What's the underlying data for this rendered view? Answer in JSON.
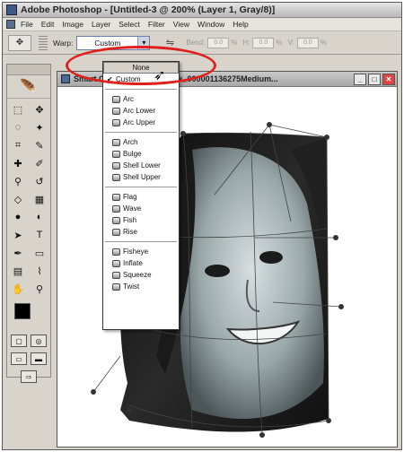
{
  "titlebar": {
    "title": "Adobe Photoshop - [Untitled-3 @ 200% (Layer 1, Gray/8)]"
  },
  "menubar": {
    "items": [
      "File",
      "Edit",
      "Image",
      "Layer",
      "Select",
      "Filter",
      "View",
      "Window",
      "Help"
    ]
  },
  "options": {
    "warp_label": "Warp:",
    "warp_value": "Custom",
    "bend_label": "Bend:",
    "bend_value": "0.0",
    "h_label": "H:",
    "h_value": "0.0",
    "v_label": "V:",
    "v_value": "0.0",
    "pct": "%"
  },
  "document": {
    "title": "Smart Object... 200% (iStock_000001136275Medium..."
  },
  "dropdown": {
    "none": "None",
    "custom": "Custom",
    "group1": [
      "Arc",
      "Arc Lower",
      "Arc Upper"
    ],
    "group2": [
      "Arch",
      "Bulge",
      "Shell Lower",
      "Shell Upper"
    ],
    "group3": [
      "Flag",
      "Wave",
      "Fish",
      "Rise"
    ],
    "group4": [
      "Fisheye",
      "Inflate",
      "Squeeze",
      "Twist"
    ]
  },
  "colors": {
    "highlight_ellipse": "#e0201c",
    "title_active": "#3c5a82"
  },
  "icons": {
    "move": "move-icon",
    "marquee": "marquee-icon",
    "lasso": "lasso-icon",
    "magic-wand": "magic-wand-icon",
    "crop": "crop-icon",
    "slice": "slice-icon"
  }
}
